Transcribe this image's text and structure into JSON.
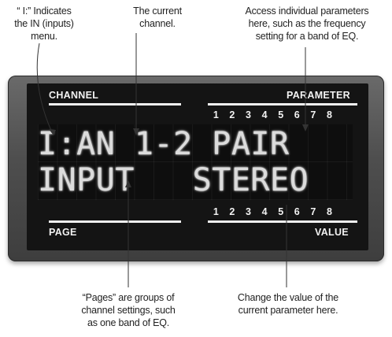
{
  "callouts": {
    "in_menu": [
      "“ I:” Indicates",
      "the IN (inputs)",
      "menu."
    ],
    "current_channel": [
      "The current",
      "channel."
    ],
    "parameters": [
      "Access individual parameters",
      "here, such as the frequency",
      "setting for a band of EQ."
    ],
    "pages": [
      "“Pages” are groups of",
      "channel settings, such",
      "as one band of EQ."
    ],
    "value": [
      "Change the value of the",
      "current parameter here."
    ]
  },
  "display": {
    "channel_label": "CHANNEL",
    "parameter_label": "PARAMETER",
    "page_label": "PAGE",
    "value_label": "VALUE",
    "top_numbers": [
      "1",
      "2",
      "3",
      "4",
      "5",
      "6",
      "7",
      "8"
    ],
    "bottom_numbers": [
      "1",
      "2",
      "3",
      "4",
      "5",
      "6",
      "7",
      "8"
    ],
    "line1": "I:AN 1-2 PAIR",
    "line2": "INPUT   STEREO"
  },
  "colors": {
    "panel": "#555555",
    "screen": "#141414",
    "lcd_text": "#dcdcdc",
    "label_text": "#f2f2f2"
  }
}
